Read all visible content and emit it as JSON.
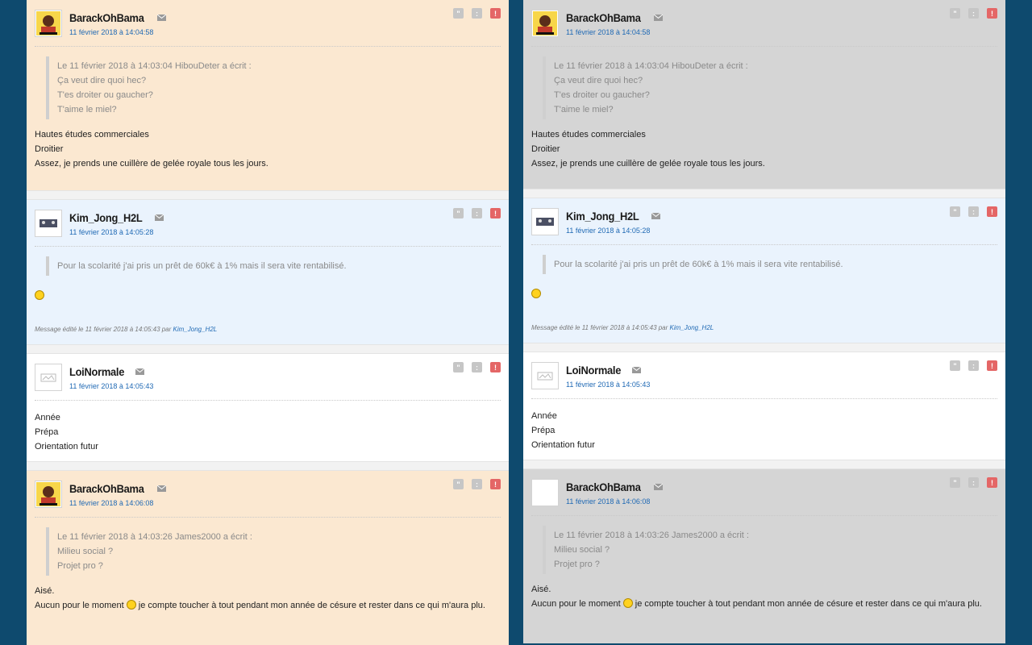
{
  "columns": [
    {
      "posts": [
        {
          "author": "BarackOhBama",
          "date": "11 février 2018 à 14:04:58",
          "quote": [
            "Le 11 février 2018 à 14:03:04 HibouDeter a écrit :",
            "Ça veut dire quoi hec?",
            "T'es droiter ou gaucher?",
            "T'aime le miel?"
          ],
          "body": [
            "Hautes études commerciales",
            "Droitier",
            "Assez, je prends une cuillère de gelée royale tous les jours."
          ]
        },
        {
          "author": "Kim_Jong_H2L",
          "date": "11 février 2018 à 14:05:28",
          "quote": [
            "Pour la scolarité j'ai pris un prêt de 60k€ à 1% mais il sera vite rentabilisé."
          ],
          "edited_prefix": "Message édité le 11 février 2018 à 14:05:43 par",
          "edited_by": "Kim_Jong_H2L"
        },
        {
          "author": "LoiNormale",
          "date": "11 février 2018 à 14:05:43",
          "body": [
            "Année",
            "Prépa",
            "Orientation futur"
          ]
        },
        {
          "author": "BarackOhBama",
          "date": "11 février 2018 à 14:06:08",
          "quote": [
            "Le 11 février 2018 à 14:03:26 James2000 a écrit :",
            "Milieu social ?",
            "Projet pro ?"
          ],
          "body1": "Aisé.",
          "body2a": "Aucun pour le moment",
          "body2b": "je compte toucher à tout pendant mon année de césure et rester dans ce qui m'aura plu."
        }
      ]
    },
    {
      "posts": [
        {
          "author": "BarackOhBama",
          "date": "11 février 2018 à 14:04:58",
          "quote": [
            "Le 11 février 2018 à 14:03:04 HibouDeter a écrit :",
            "Ça veut dire quoi hec?",
            "T'es droiter ou gaucher?",
            "T'aime le miel?"
          ],
          "body": [
            "Hautes études commerciales",
            "Droitier",
            "Assez, je prends une cuillère de gelée royale tous les jours."
          ]
        },
        {
          "author": "Kim_Jong_H2L",
          "date": "11 février 2018 à 14:05:28",
          "quote": [
            "Pour la scolarité j'ai pris un prêt de 60k€ à 1% mais il sera vite rentabilisé."
          ],
          "edited_prefix": "Message édité le 11 février 2018 à 14:05:43 par",
          "edited_by": "Kim_Jong_H2L"
        },
        {
          "author": "LoiNormale",
          "date": "11 février 2018 à 14:05:43",
          "body": [
            "Année",
            "Prépa",
            "Orientation futur"
          ]
        },
        {
          "author": "BarackOhBama",
          "date": "11 février 2018 à 14:06:08",
          "quote": [
            "Le 11 février 2018 à 14:03:26 James2000 a écrit :",
            "Milieu social ?",
            "Projet pro ?"
          ],
          "body1": "Aisé.",
          "body2a": "Aucun pour le moment",
          "body2b": "je compte toucher à tout pendant mon année de césure et rester dans ce qui m'aura plu."
        }
      ]
    }
  ],
  "icons": {
    "mail": "envelope-icon",
    "quote": "quote-icon",
    "mp": "private-message-icon",
    "alert": "report-icon"
  },
  "colors": {
    "background": "#0e4a6e",
    "beige_post": "#fbe8d1",
    "blue_post": "#eaf3fd",
    "gray_post": "#d5d5d5",
    "link": "#1f69b4",
    "alert": "#e46666"
  }
}
